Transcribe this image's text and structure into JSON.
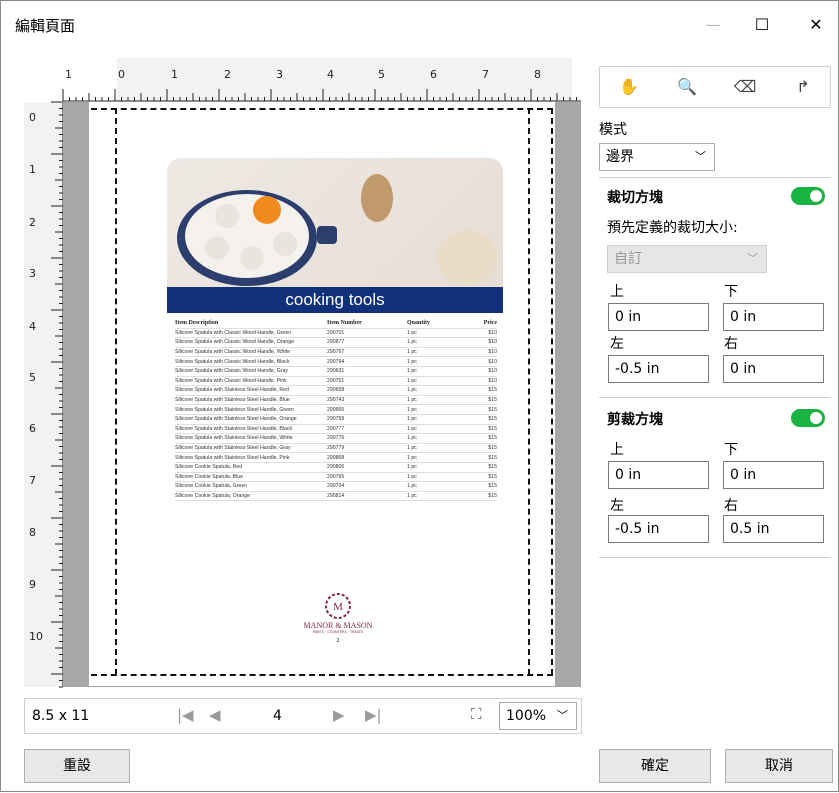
{
  "window": {
    "title": "編輯頁面",
    "minimize": "—",
    "maximize": "☐",
    "close": "✕"
  },
  "ruler": {
    "top_labels": [
      "1",
      "0",
      "1",
      "2",
      "3",
      "4",
      "5",
      "6",
      "7",
      "8"
    ],
    "left_labels": [
      "0",
      "1",
      "2",
      "3",
      "4",
      "5",
      "6",
      "7",
      "8",
      "9",
      "10"
    ]
  },
  "preview": {
    "banner": "cooking tools",
    "columns": [
      "Item Description",
      "Item Number",
      "Quantity",
      "Price"
    ],
    "rows": [
      [
        "Silicone Spatula with Classic Wood Handle, Green",
        "290701",
        "1 pc",
        "$10"
      ],
      [
        "Silicone Spatula with Classic Wood Handle, Orange",
        "290877",
        "1 pc",
        "$10"
      ],
      [
        "Silicone Spatula with Classic Wood Handle, White",
        "290767",
        "1 pc",
        "$10"
      ],
      [
        "Silicone Spatula with Classic Wood Handle, Black",
        "290794",
        "1 pc",
        "$10"
      ],
      [
        "Silicone Spatula with Classic Wood Handle, Gray",
        "290631",
        "1 pc",
        "$10"
      ],
      [
        "Silicone Spatula with Classic Wood Handle, Pink",
        "290751",
        "1 pc",
        "$10"
      ],
      [
        "Silicone Spatula with Stainless Steel Handle, Red",
        "290658",
        "1 pc",
        "$15"
      ],
      [
        "Silicone Spatula with Stainless Steel Handle, Blue",
        "290743",
        "1 pc",
        "$15"
      ],
      [
        "Silicone Spatula with Stainless Steel Handle, Green",
        "290665",
        "1 pc",
        "$15"
      ],
      [
        "Silicone Spatula with Stainless Steel Handle, Orange",
        "290759",
        "1 pc",
        "$15"
      ],
      [
        "Silicone Spatula with Stainless Steel Handle, Black",
        "290777",
        "1 pc",
        "$15"
      ],
      [
        "Silicone Spatula with Stainless Steel Handle, White",
        "290776",
        "1 pc",
        "$15"
      ],
      [
        "Silicone Spatula with Stainless Steel Handle, Gray",
        "290779",
        "1 pc",
        "$15"
      ],
      [
        "Silicone Spatula with Stainless Steel Handle, Pink",
        "290868",
        "1 pc",
        "$15"
      ],
      [
        "Silicone Cookie Spatula, Red",
        "290806",
        "1 pc",
        "$15"
      ],
      [
        "Silicone Cookie Spatula, Blue",
        "290765",
        "1 pc",
        "$15"
      ],
      [
        "Silicone Cookie Spatula, Green",
        "290704",
        "1 pc",
        "$15"
      ],
      [
        "Silicone Cookie Spatula, Orange",
        "290814",
        "1 pc",
        "$15"
      ]
    ],
    "logo_letter": "M",
    "brand": "MANOR & MASON",
    "brand_sub": "PANTS · COUNTERS · TREATS",
    "page_number": "2"
  },
  "footer_bar": {
    "paper_size": "8.5 x 11",
    "page": "4",
    "zoom": "100%"
  },
  "tools": {
    "hand": "hand-icon",
    "zoom": "magnifier-icon",
    "eraser": "eraser-icon",
    "rotate": "rotate-icon"
  },
  "panel": {
    "mode_label": "模式",
    "mode_value": "邊界",
    "crop_title": "裁切方塊",
    "crop_enabled": true,
    "preset_label": "預先定義的裁切大小:",
    "preset_value": "自訂",
    "crop_top_label": "上",
    "crop_top": "0 in",
    "crop_bottom_label": "下",
    "crop_bottom": "0 in",
    "crop_left_label": "左",
    "crop_left": "-0.5 in",
    "crop_right_label": "右",
    "crop_right": "0 in",
    "trim_title": "剪裁方塊",
    "trim_enabled": true,
    "trim_top_label": "上",
    "trim_top": "0 in",
    "trim_bottom_label": "下",
    "trim_bottom": "0 in",
    "trim_left_label": "左",
    "trim_left": "-0.5 in",
    "trim_right_label": "右",
    "trim_right": "0.5 in"
  },
  "buttons": {
    "reset": "重設",
    "ok": "確定",
    "cancel": "取消"
  },
  "colors": {
    "toggle_on": "#1ab341",
    "banner": "#10317a",
    "tool_accent": "#1a6fd1"
  }
}
